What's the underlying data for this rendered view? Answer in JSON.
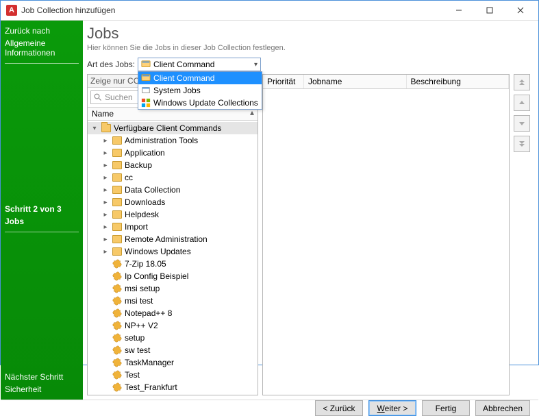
{
  "window": {
    "title": "Job Collection hinzufügen"
  },
  "sidebar": {
    "back": "Zurück nach",
    "step1": "Allgemeine Informationen",
    "current_step": "Schritt 2 von 3",
    "current_label": "Jobs",
    "next": "Nächster Schritt",
    "step3": "Sicherheit"
  },
  "main": {
    "heading": "Jobs",
    "subheading": "Hier können Sie die Jobs in dieser Job Collection festlegen.",
    "jobtype_label": "Art des Jobs:",
    "combo_value": "Client Command",
    "dropdown": {
      "opt1": "Client Command",
      "opt2": "System Jobs",
      "opt3": "Windows Update Collections"
    },
    "show_only_label": "Zeige nur CCs",
    "search_placeholder": "Suchen",
    "col_name": "Name",
    "table": {
      "col_prio": "Priorität",
      "col_jobname": "Jobname",
      "col_desc": "Beschreibung"
    }
  },
  "tree": {
    "root": "Verfügbare Client Commands",
    "folders": {
      "f0": "Administration Tools",
      "f1": "Application",
      "f2": "Backup",
      "f3": "cc",
      "f4": "Data Collection",
      "f5": "Downloads",
      "f6": "Helpdesk",
      "f7": "Import",
      "f8": "Remote Administration",
      "f9": "Windows Updates"
    },
    "items": {
      "i0": "7-Zip 18.05",
      "i1": "Ip Config Beispiel",
      "i2": "msi setup",
      "i3": "msi test",
      "i4": "Notepad++ 8",
      "i5": "NP++ V2",
      "i6": "setup",
      "i7": "sw test",
      "i8": "TaskManager",
      "i9": "Test",
      "i10": "Test_Frankfurt"
    }
  },
  "footer": {
    "back": "< Zurück",
    "next": "Weiter >",
    "finish": "Fertig",
    "cancel": "Abbrechen"
  }
}
